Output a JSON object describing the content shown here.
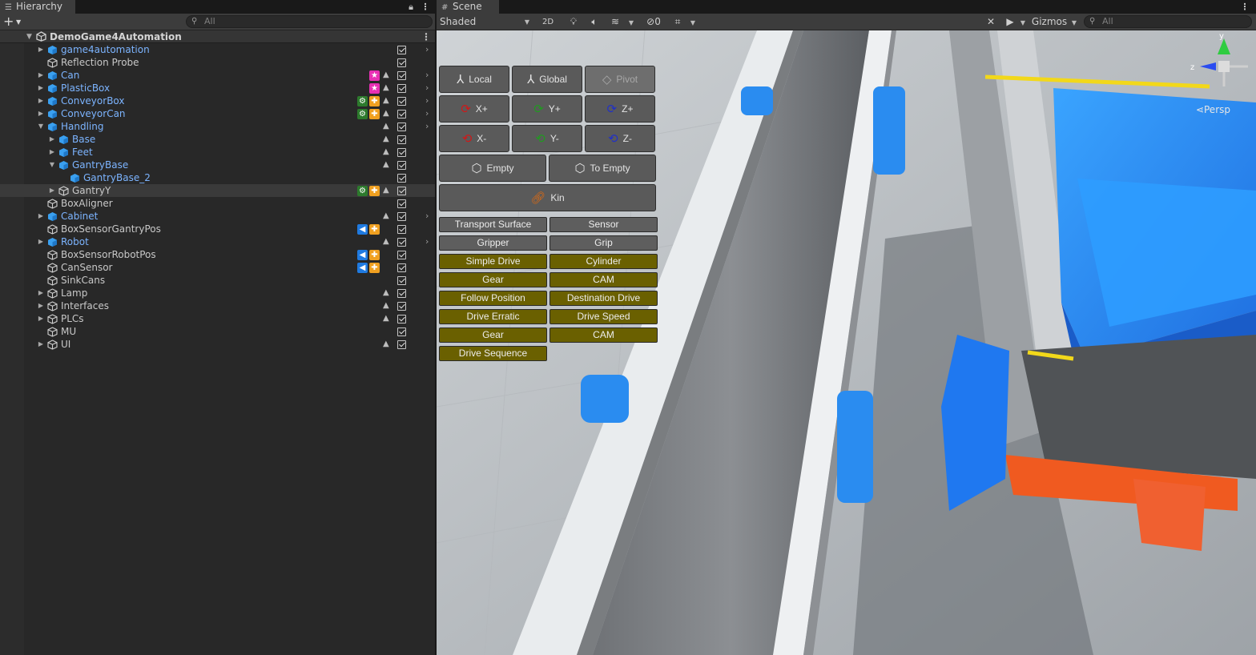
{
  "hierarchy": {
    "tab_title": "Hierarchy",
    "search_placeholder": "All",
    "scene_name": "DemoGame4Automation",
    "rows": [
      {
        "label": "game4automation",
        "prefab": true
      },
      {
        "label": "Reflection Probe",
        "prefab": false
      },
      {
        "label": "Can",
        "prefab": true
      },
      {
        "label": "PlasticBox",
        "prefab": true
      },
      {
        "label": "ConveyorBox",
        "prefab": true
      },
      {
        "label": "ConveyorCan",
        "prefab": true
      },
      {
        "label": "Handling",
        "prefab": true
      },
      {
        "label": "Base",
        "prefab": true
      },
      {
        "label": "Feet",
        "prefab": true
      },
      {
        "label": "GantryBase",
        "prefab": true
      },
      {
        "label": "GantryBase_2",
        "prefab": true
      },
      {
        "label": "GantryY",
        "prefab": false
      },
      {
        "label": "BoxAligner",
        "prefab": false
      },
      {
        "label": "Cabinet",
        "prefab": true
      },
      {
        "label": "BoxSensorGantryPos",
        "prefab": false
      },
      {
        "label": "Robot",
        "prefab": true
      },
      {
        "label": "BoxSensorRobotPos",
        "prefab": false
      },
      {
        "label": "CanSensor",
        "prefab": false
      },
      {
        "label": "SinkCans",
        "prefab": false
      },
      {
        "label": "Lamp",
        "prefab": false
      },
      {
        "label": "Interfaces",
        "prefab": false
      },
      {
        "label": "PLCs",
        "prefab": false
      },
      {
        "label": "MU",
        "prefab": false
      },
      {
        "label": "UI",
        "prefab": false
      }
    ]
  },
  "scene": {
    "tab_title": "Scene",
    "shading_mode": "Shaded",
    "mode_2d": "2D",
    "hidden_count": "0",
    "gizmos_label": "Gizmos",
    "search_placeholder": "All",
    "persp_label": "Persp",
    "axis_y": "y",
    "axis_z": "z"
  },
  "gizmo_panel": {
    "local": "Local",
    "global": "Global",
    "pivot": "Pivot",
    "x_plus": "X+",
    "y_plus": "Y+",
    "z_plus": "Z+",
    "x_minus": "X-",
    "y_minus": "Y-",
    "z_minus": "Z-",
    "empty": "Empty",
    "to_empty": "To Empty",
    "kin": "Kin",
    "components": [
      {
        "label": "Transport Surface",
        "style": "gray"
      },
      {
        "label": "Sensor",
        "style": "gray"
      },
      {
        "label": "Gripper",
        "style": "gray"
      },
      {
        "label": "Grip",
        "style": "gray"
      },
      {
        "label": "Simple Drive",
        "style": "olive"
      },
      {
        "label": "Cylinder",
        "style": "olive"
      },
      {
        "label": "Gear",
        "style": "olive"
      },
      {
        "label": "CAM",
        "style": "olive"
      },
      {
        "label": "Follow Position",
        "style": "olive"
      },
      {
        "label": "Destination Drive",
        "style": "olive"
      },
      {
        "label": "Drive Erratic",
        "style": "olive"
      },
      {
        "label": "Drive Speed",
        "style": "olive"
      },
      {
        "label": "Gear",
        "style": "olive"
      },
      {
        "label": "CAM",
        "style": "olive"
      },
      {
        "label": "Drive Sequence",
        "style": "olive"
      }
    ]
  },
  "colors": {
    "prefab_text": "#7cb4ff",
    "olive_button": "#6a6000",
    "gray_button": "#5e5e5e",
    "conveyor_blue": "#2a8cf0",
    "base_orange": "#f05a20"
  }
}
